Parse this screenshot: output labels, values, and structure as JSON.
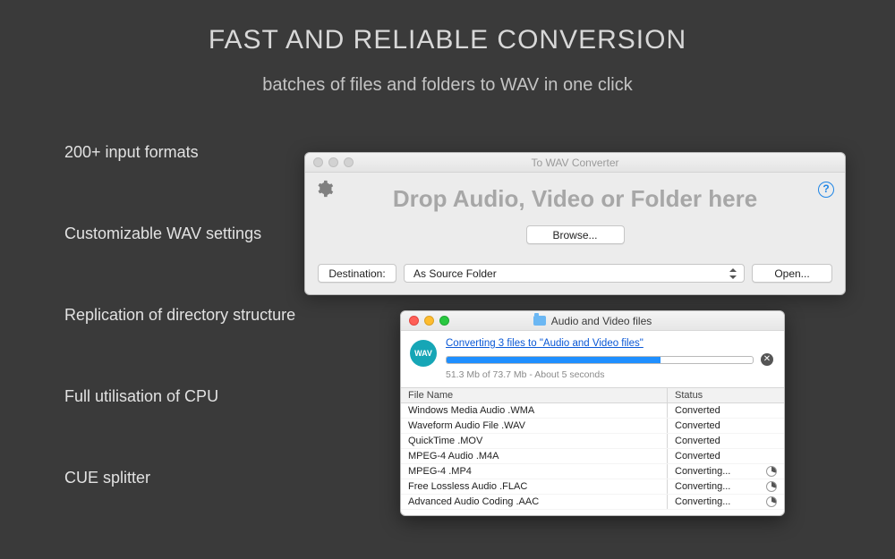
{
  "headline": "FAST AND RELIABLE CONVERSION",
  "subhead": "batches of files and folders to WAV in one click",
  "features": [
    "200+ input formats",
    "Customizable WAV settings",
    "Replication of directory structure",
    "Full utilisation of CPU",
    "CUE splitter"
  ],
  "drop_window": {
    "title": "To WAV Converter",
    "drop_text": "Drop Audio, Video or Folder here",
    "browse_label": "Browse...",
    "destination_label": "Destination:",
    "destination_value": "As Source Folder",
    "open_label": "Open...",
    "help_label": "?"
  },
  "progress_window": {
    "title": "Audio and Video files",
    "badge_text": "WAV",
    "link_text": "Converting 3 files to \"Audio and Video files\"",
    "progress_percent": 70,
    "progress_text": "51.3 Mb of 73.7 Mb - About 5 seconds",
    "columns": {
      "name": "File Name",
      "status": "Status"
    },
    "rows": [
      {
        "name": "Windows Media Audio .WMA",
        "status": "Converted",
        "spinner": false
      },
      {
        "name": "Waveform Audio File .WAV",
        "status": "Converted",
        "spinner": false
      },
      {
        "name": "QuickTime .MOV",
        "status": "Converted",
        "spinner": false
      },
      {
        "name": "MPEG-4 Audio .M4A",
        "status": "Converted",
        "spinner": false
      },
      {
        "name": "MPEG-4 .MP4",
        "status": "Converting...",
        "spinner": true
      },
      {
        "name": "Free Lossless Audio .FLAC",
        "status": "Converting...",
        "spinner": true
      },
      {
        "name": "Advanced Audio Coding .AAC",
        "status": "Converting...",
        "spinner": true
      }
    ]
  }
}
